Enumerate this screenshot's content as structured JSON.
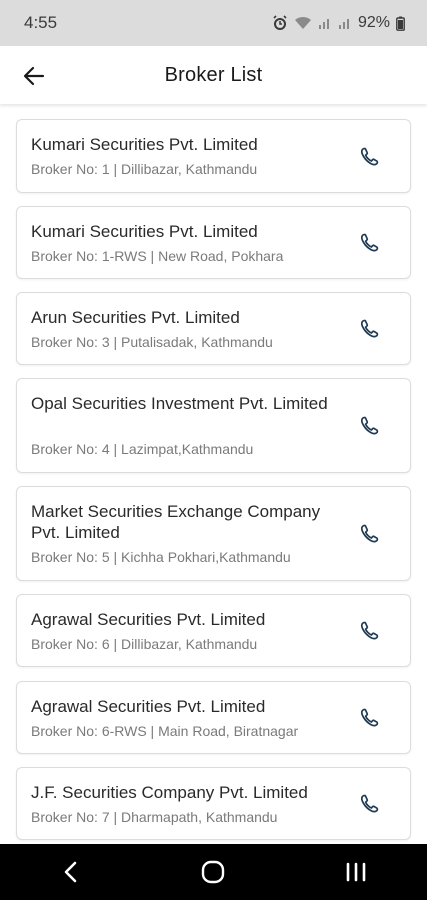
{
  "status_bar": {
    "time": "4:55",
    "battery": "92%"
  },
  "app_bar": {
    "title": "Broker List"
  },
  "brokers": [
    {
      "name": "Kumari Securities Pvt. Limited",
      "broker_no_label": "Broker No:",
      "broker_no": "1",
      "address": "Dillibazar, Kathmandu"
    },
    {
      "name": "Kumari Securities Pvt. Limited",
      "broker_no_label": "Broker No:",
      "broker_no": "1-RWS",
      "address": "New Road, Pokhara"
    },
    {
      "name": "Arun Securities Pvt. Limited",
      "broker_no_label": "Broker No:",
      "broker_no": "3",
      "address": "Putalisadak, Kathmandu"
    },
    {
      "name": "Opal Securities Investment Pvt. Limited",
      "broker_no_label": "Broker No:",
      "broker_no": "4",
      "address": "Lazimpat,Kathmandu"
    },
    {
      "name": "Market Securities Exchange Company Pvt. Limited",
      "broker_no_label": "Broker No:",
      "broker_no": "5",
      "address": "Kichha Pokhari,Kathmandu"
    },
    {
      "name": "Agrawal Securities Pvt. Limited",
      "broker_no_label": "Broker No:",
      "broker_no": "6",
      "address": "Dillibazar, Kathmandu"
    },
    {
      "name": "Agrawal Securities Pvt. Limited",
      "broker_no_label": "Broker No:",
      "broker_no": "6-RWS",
      "address": "Main Road, Biratnagar"
    },
    {
      "name": "J.F. Securities Company Pvt. Limited",
      "broker_no_label": "Broker No:",
      "broker_no": "7",
      "address": "Dharmapath, Kathmandu"
    }
  ],
  "icons": {
    "back": "arrow-left-icon",
    "call": "phone-icon",
    "nav_back": "chevron-left-icon",
    "nav_home": "circle-home-icon",
    "nav_recents": "recents-icon"
  },
  "colors": {
    "phone_icon": "#1f3a52",
    "status_bar_bg": "#dcdcdc",
    "nav_bar_bg": "#000000"
  }
}
